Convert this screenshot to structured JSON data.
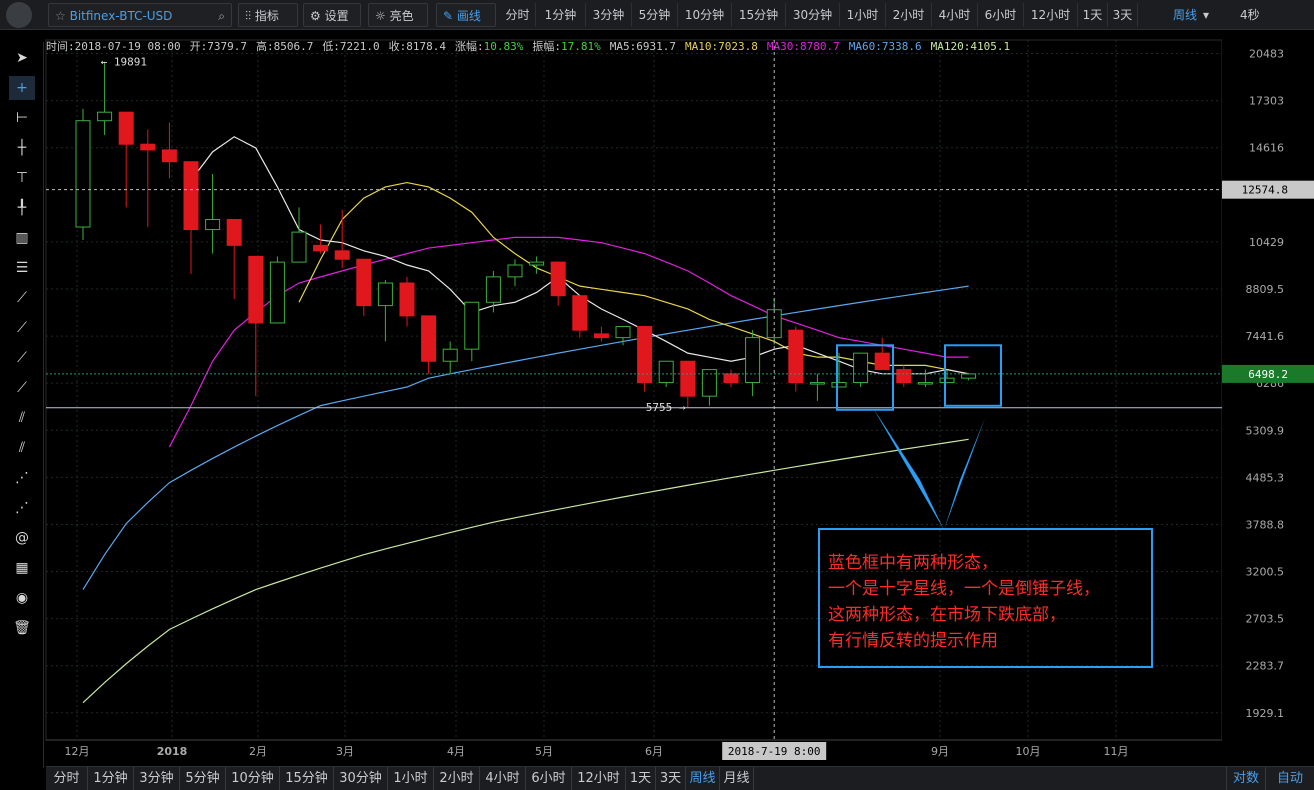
{
  "toolbar": {
    "symbol": "Bitfinex-BTC-USD",
    "indicator_label": "指标",
    "settings_label": "设置",
    "brightness_label": "亮色",
    "draw_label": "画线",
    "intervals": [
      "分时",
      "1分钟",
      "3分钟",
      "5分钟",
      "10分钟",
      "15分钟",
      "30分钟",
      "1小时",
      "2小时",
      "4小时",
      "6小时",
      "12小时",
      "1天",
      "3天"
    ],
    "period_selected": "周线",
    "refresh": "4秒"
  },
  "info": {
    "time": "时间:2018-07-19 08:00",
    "open": "开:7379.7",
    "high": "高:8506.7",
    "low": "低:7221.0",
    "close": "收:8178.4",
    "change_label": "涨幅:",
    "change": "10.83%",
    "amp_label": "振幅:",
    "amp": "17.81%",
    "ma5": "MA5:6931.7",
    "ma10": "MA10:7023.8",
    "ma30": "MA30:8780.7",
    "ma60": "MA60:7338.6",
    "ma120": "MA120:4105.1"
  },
  "bottom": {
    "intervals": [
      "分时",
      "1分钟",
      "3分钟",
      "5分钟",
      "10分钟",
      "15分钟",
      "30分钟",
      "1小时",
      "2小时",
      "4小时",
      "6小时",
      "12小时",
      "1天",
      "3天",
      "周线",
      "月线"
    ],
    "active": "周线",
    "log_label": "对数",
    "auto_label": "自动"
  },
  "annotation": {
    "lines": [
      "蓝色框中有两种形态，",
      "一个是十字星线，一个是倒锤子线，",
      "这两种形态，在市场下跌底部，",
      "有行情反转的提示作用"
    ]
  },
  "colors": {
    "up": "#3fae3f",
    "down": "#e0181e",
    "ma5": "#e8e8e8",
    "ma10": "#e8d44a",
    "ma30": "#e020e0",
    "ma60": "#5aa8f0",
    "ma120": "#c8e8a0",
    "annotation": "#2a9df4"
  },
  "chart_data": {
    "type": "candlestick",
    "y_scale": "log",
    "ylim": [
      1750,
      21500
    ],
    "y_ticks": [
      20483,
      17303,
      14616,
      10429,
      8809.5,
      7441.6,
      6286,
      5309.9,
      4485.3,
      3788.8,
      3200.5,
      2703.5,
      2283.7,
      1929.1
    ],
    "x_labels": [
      "12月",
      "2018",
      "2月",
      "3月",
      "4月",
      "5月",
      "6月",
      "9月",
      "10月",
      "11月"
    ],
    "crosshair_price": "12574.8",
    "crosshair_price_value": 12574.8,
    "crosshair_time": "2018-7-19 8:00",
    "last_price": "6498.2",
    "last_price_value": 6498.2,
    "high_mark": "19891",
    "high_mark_value": 19891,
    "low_mark": "5755",
    "low_mark_value": 5755,
    "candles": [
      {
        "o": 11000,
        "h": 16800,
        "l": 10500,
        "c": 16100
      },
      {
        "o": 16100,
        "h": 19891,
        "l": 15300,
        "c": 16600
      },
      {
        "o": 16600,
        "h": 16600,
        "l": 11800,
        "c": 14800
      },
      {
        "o": 14800,
        "h": 15600,
        "l": 11000,
        "c": 14500
      },
      {
        "o": 14500,
        "h": 16000,
        "l": 13100,
        "c": 13900
      },
      {
        "o": 13900,
        "h": 13900,
        "l": 9300,
        "c": 10900
      },
      {
        "o": 10900,
        "h": 13300,
        "l": 10000,
        "c": 11300
      },
      {
        "o": 11300,
        "h": 11300,
        "l": 8500,
        "c": 10300
      },
      {
        "o": 9900,
        "h": 9900,
        "l": 6000,
        "c": 7800
      },
      {
        "o": 7800,
        "h": 9900,
        "l": 7800,
        "c": 9700
      },
      {
        "o": 9700,
        "h": 11800,
        "l": 9700,
        "c": 10800
      },
      {
        "o": 10300,
        "h": 11100,
        "l": 10000,
        "c": 10100
      },
      {
        "o": 10100,
        "h": 11700,
        "l": 9500,
        "c": 9800
      },
      {
        "o": 9800,
        "h": 9800,
        "l": 8000,
        "c": 8300
      },
      {
        "o": 8300,
        "h": 9100,
        "l": 7300,
        "c": 9000
      },
      {
        "o": 9000,
        "h": 9200,
        "l": 7700,
        "c": 8000
      },
      {
        "o": 8000,
        "h": 8000,
        "l": 6500,
        "c": 6800
      },
      {
        "o": 6800,
        "h": 7300,
        "l": 6500,
        "c": 7100
      },
      {
        "o": 7100,
        "h": 8400,
        "l": 6800,
        "c": 8400
      },
      {
        "o": 8400,
        "h": 9400,
        "l": 8100,
        "c": 9200
      },
      {
        "o": 9200,
        "h": 9800,
        "l": 8900,
        "c": 9600
      },
      {
        "o": 9600,
        "h": 9900,
        "l": 9300,
        "c": 9700
      },
      {
        "o": 9700,
        "h": 9700,
        "l": 8300,
        "c": 8600
      },
      {
        "o": 8600,
        "h": 8600,
        "l": 7400,
        "c": 7600
      },
      {
        "o": 7500,
        "h": 7700,
        "l": 7300,
        "c": 7400
      },
      {
        "o": 7400,
        "h": 7700,
        "l": 7200,
        "c": 7700
      },
      {
        "o": 7700,
        "h": 7700,
        "l": 6100,
        "c": 6300
      },
      {
        "o": 6300,
        "h": 6800,
        "l": 6200,
        "c": 6800
      },
      {
        "o": 6800,
        "h": 6800,
        "l": 5755,
        "c": 6000
      },
      {
        "o": 6000,
        "h": 6600,
        "l": 5800,
        "c": 6600
      },
      {
        "o": 6500,
        "h": 6600,
        "l": 6200,
        "c": 6300
      },
      {
        "o": 6300,
        "h": 7600,
        "l": 6000,
        "c": 7400
      },
      {
        "o": 7400,
        "h": 8506.7,
        "l": 7221,
        "c": 8178.4
      },
      {
        "o": 7600,
        "h": 7700,
        "l": 6100,
        "c": 6300
      },
      {
        "o": 6300,
        "h": 6500,
        "l": 5900,
        "c": 6300
      },
      {
        "o": 6200,
        "h": 7000,
        "l": 6200,
        "c": 6300
      },
      {
        "o": 6300,
        "h": 7000,
        "l": 6200,
        "c": 7000
      },
      {
        "o": 7000,
        "h": 7400,
        "l": 6600,
        "c": 6600
      },
      {
        "o": 6600,
        "h": 6700,
        "l": 6200,
        "c": 6300
      },
      {
        "o": 6300,
        "h": 6600,
        "l": 6200,
        "c": 6300
      },
      {
        "o": 6300,
        "h": 6600,
        "l": 6300,
        "c": 6400
      },
      {
        "o": 6400,
        "h": 6500,
        "l": 6350,
        "c": 6498.2
      }
    ],
    "ma5": [
      null,
      null,
      null,
      null,
      null,
      13000,
      14400,
      15200,
      14600,
      12700,
      10900,
      10500,
      10400,
      10100,
      9900,
      9600,
      9400,
      8800,
      8100,
      8300,
      8400,
      8700,
      9200,
      8600,
      8200,
      7900,
      7600,
      7300,
      7000,
      6900,
      6800,
      6900,
      7100,
      7200,
      7000,
      6800,
      6600,
      6500,
      6500,
      6500,
      6600,
      6500
    ],
    "ma10": [
      null,
      null,
      null,
      null,
      null,
      null,
      null,
      null,
      null,
      null,
      8400,
      9800,
      11300,
      12200,
      12700,
      12900,
      12700,
      12200,
      11600,
      10600,
      10000,
      9500,
      9200,
      8900,
      8800,
      8700,
      8600,
      8400,
      8200,
      7900,
      7700,
      7500,
      7300,
      7000,
      6900,
      6900,
      6800,
      6700,
      6700,
      6700,
      6600,
      6500
    ],
    "ma30": [
      null,
      null,
      null,
      null,
      5000,
      5800,
      6800,
      7600,
      8100,
      8600,
      9000,
      9200,
      9400,
      9600,
      9800,
      10000,
      10200,
      10300,
      10400,
      10500,
      10600,
      10600,
      10600,
      10500,
      10400,
      10200,
      10000,
      9700,
      9400,
      9000,
      8600,
      8300,
      8000,
      7800,
      7600,
      7400,
      7300,
      7200,
      7100,
      7000,
      6900,
      6900
    ],
    "ma60": [
      3000,
      3400,
      3800,
      4100,
      4400,
      4600,
      4800,
      5000,
      5200,
      5400,
      5600,
      5800,
      5900,
      6000,
      6100,
      6200,
      6400,
      6500,
      6600,
      6700,
      6800,
      6900,
      7000,
      7100,
      7200,
      7300,
      7400,
      7500,
      7600,
      7700,
      7800,
      7900,
      8000,
      8100,
      8200,
      8300,
      8400,
      8500,
      8600,
      8700,
      8800,
      8900
    ],
    "ma120": [
      1800,
      2000,
      2200,
      2400,
      2550,
      2700,
      2850,
      2950,
      3050,
      3150,
      3250,
      3350,
      3450,
      3550,
      3650,
      3750,
      3850,
      3950,
      4050,
      4150,
      4250,
      4350,
      4450,
      4550,
      4650,
      4750,
      4850,
      4950,
      5050,
      5150,
      5250,
      5350,
      5450,
      5550,
      5650,
      5750,
      5850,
      5950,
      6050,
      6150,
      6250,
      6350
    ],
    "ma120_visible": [
      2000,
      2150,
      2300,
      2450,
      2600,
      2700,
      2800,
      2900,
      3000,
      3080,
      3160,
      3240,
      3320,
      3400,
      3470,
      3540,
      3610,
      3680,
      3750,
      3820,
      3880,
      3940,
      4000,
      4060,
      4120,
      4180,
      4240,
      4300,
      4360,
      4420,
      4480,
      4540,
      4600,
      4660,
      4720,
      4780,
      4840,
      4900,
      4960,
      5020,
      5080,
      5140
    ]
  }
}
